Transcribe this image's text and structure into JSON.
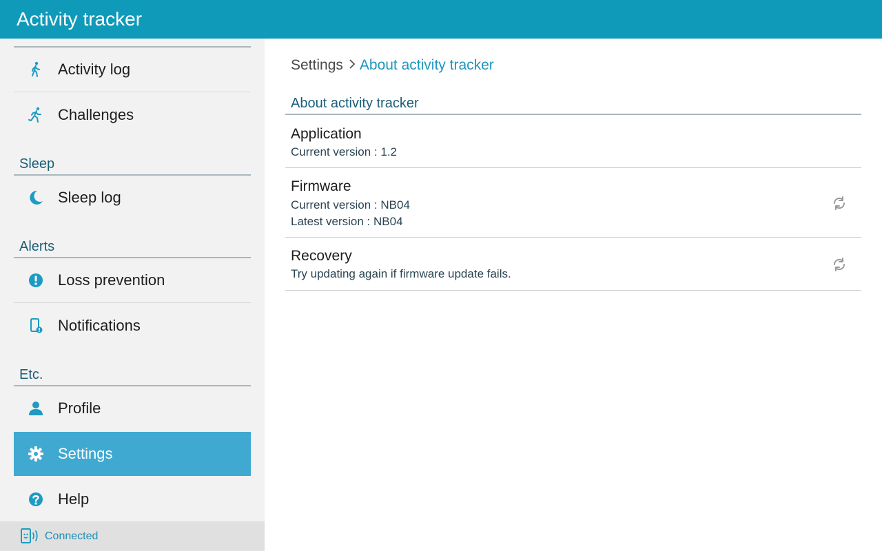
{
  "app": {
    "title": "Activity tracker"
  },
  "sidebar": {
    "items_top": [
      {
        "label": "Activity log",
        "icon": "walk-icon"
      },
      {
        "label": "Challenges",
        "icon": "run-icon"
      }
    ],
    "sections": [
      {
        "title": "Sleep",
        "items": [
          {
            "label": "Sleep log",
            "icon": "moon-icon"
          }
        ]
      },
      {
        "title": "Alerts",
        "items": [
          {
            "label": "Loss prevention",
            "icon": "exclamation-icon"
          },
          {
            "label": "Notifications",
            "icon": "phone-notification-icon"
          }
        ]
      },
      {
        "title": "Etc.",
        "items": [
          {
            "label": "Profile",
            "icon": "person-icon"
          },
          {
            "label": "Settings",
            "icon": "gear-icon",
            "selected": true
          },
          {
            "label": "Help",
            "icon": "question-icon"
          }
        ]
      }
    ],
    "status": {
      "label": "Connected",
      "icon": "device-connected-icon"
    }
  },
  "main": {
    "breadcrumb": {
      "parent": "Settings",
      "current": "About activity tracker"
    },
    "section_title": "About activity tracker",
    "rows": [
      {
        "title": "Application",
        "lines": [
          "Current version : 1.2"
        ],
        "refresh": false
      },
      {
        "title": "Firmware",
        "lines": [
          "Current version : NB04",
          "Latest version : NB04"
        ],
        "refresh": true
      },
      {
        "title": "Recovery",
        "lines": [
          "Try updating again if firmware update fails."
        ],
        "refresh": true
      }
    ]
  },
  "colors": {
    "appbar": "#0f9aba",
    "accent": "#1e97c0",
    "selected": "#3fa9d1",
    "icon": "#1d9bc2"
  }
}
